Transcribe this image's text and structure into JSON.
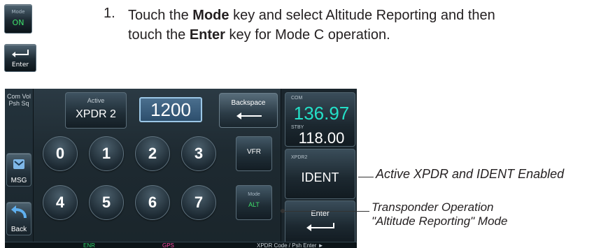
{
  "instruction": {
    "number": "1.",
    "parts": {
      "p1": "Touch the ",
      "b1": "Mode",
      "p2": " key and select Altitude Reporting and then",
      "p3": "touch the ",
      "b2": "Enter",
      "p4": " key for Mode C operation."
    }
  },
  "side_keys": {
    "mode": {
      "small": "Mode",
      "big": "ON"
    },
    "enter": {
      "label": "Enter"
    }
  },
  "device": {
    "left": {
      "comvol_line1": "Com Vol",
      "comvol_line2": "Psh Sq",
      "msg": "MSG",
      "back": "Back"
    },
    "active": {
      "label": "Active",
      "value": "XPDR 2"
    },
    "code": "1200",
    "backspace": "Backspace",
    "keypad": [
      "0",
      "1",
      "2",
      "3",
      "4",
      "5",
      "6",
      "7"
    ],
    "vfr": "VFR",
    "mode_key": {
      "small": "Mode",
      "big": "ALT"
    },
    "com": {
      "label": "COM",
      "active_freq": "136.97",
      "standby_label": "STBY",
      "standby_freq": "118.00"
    },
    "xpdr_panel": {
      "label": "XPDR2",
      "value": "IDENT"
    },
    "enter": "Enter",
    "status": {
      "enr": "ENR",
      "gps": "GPS",
      "hint": "XPDR Code / Psh Enter ►"
    }
  },
  "callouts": {
    "active_ident": "Active XPDR and IDENT Enabled",
    "operation_line1": "Transponder Operation",
    "operation_line2": "\"Altitude Reporting\" Mode"
  },
  "colors": {
    "com_freq": "#24e0c8",
    "mode_on": "#3fe06a",
    "code_highlight": "#9cc7e6",
    "status_enr": "#2fd36a",
    "status_gps": "#ff4aa6"
  }
}
